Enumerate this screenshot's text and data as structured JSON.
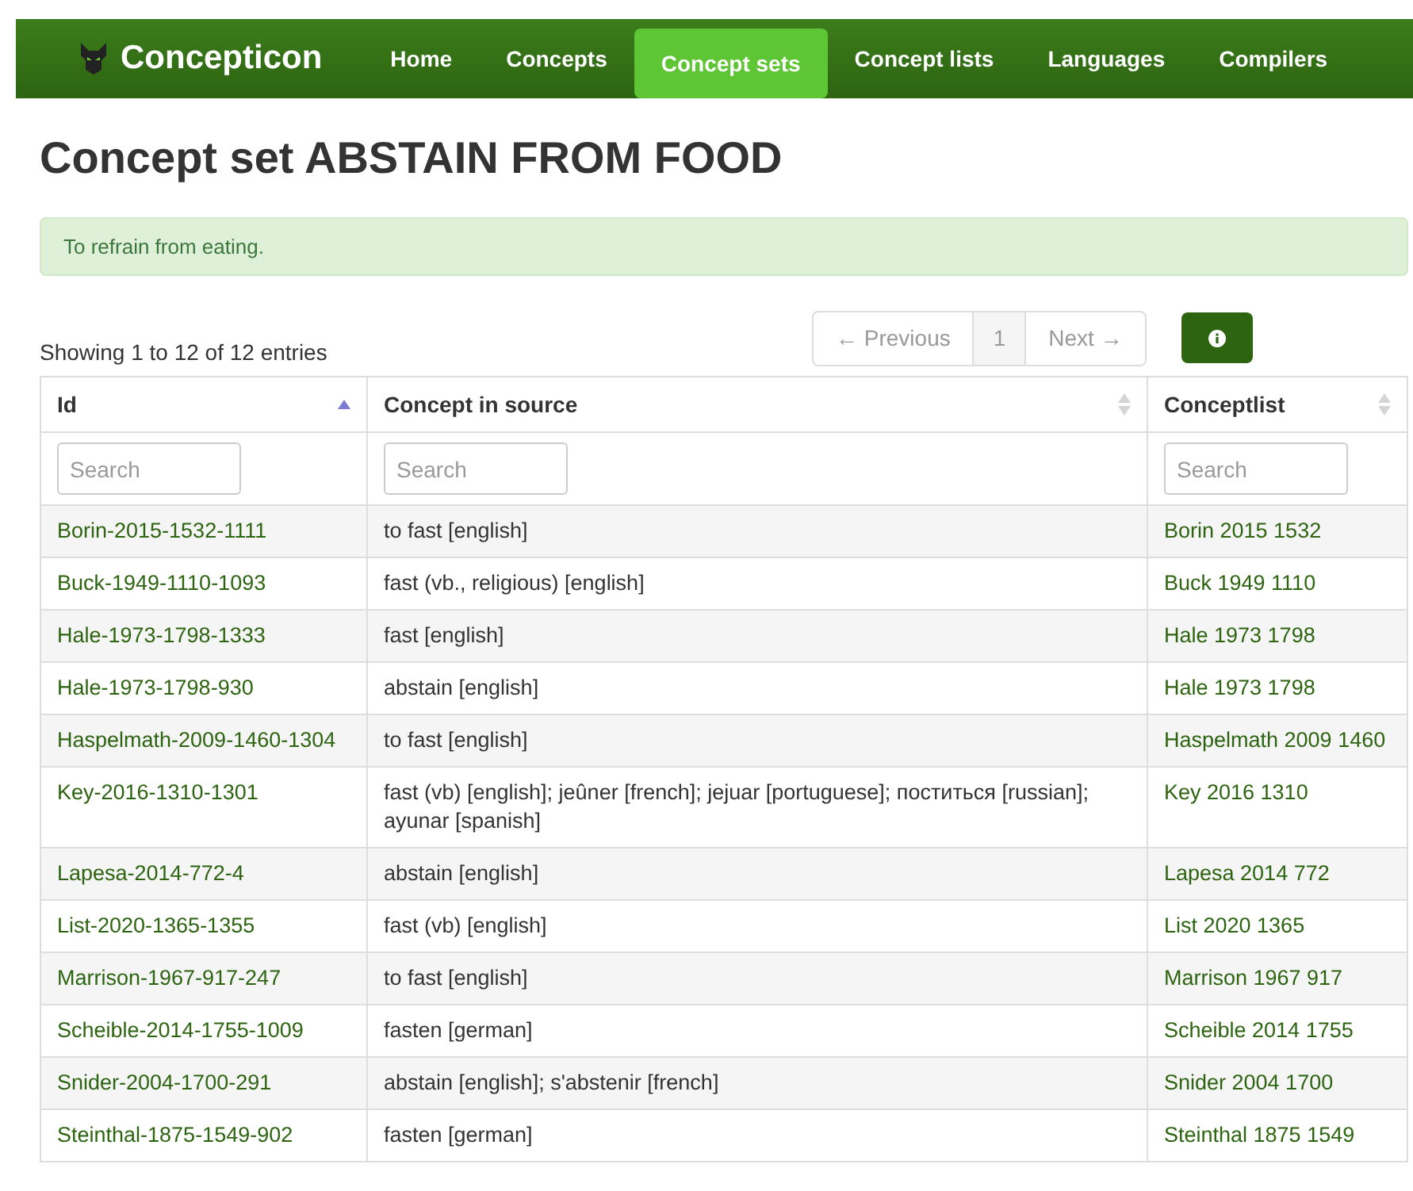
{
  "navbar": {
    "brand": "Concepticon",
    "items": [
      {
        "label": "Home",
        "selected": false
      },
      {
        "label": "Concepts",
        "selected": false
      },
      {
        "label": "Concept sets",
        "selected": true
      },
      {
        "label": "Concept lists",
        "selected": false
      },
      {
        "label": "Languages",
        "selected": false
      },
      {
        "label": "Compilers",
        "selected": false
      }
    ]
  },
  "title": "Concept set ABSTAIN FROM FOOD",
  "alert": "To refrain from eating.",
  "table_info": "Showing 1 to 12 of 12 entries",
  "pagination": [
    {
      "label": "← Previous",
      "selected": false
    },
    {
      "label": "1",
      "selected": true
    },
    {
      "label": "Next →",
      "selected": false
    }
  ],
  "table": {
    "columns": [
      {
        "label": "Id",
        "sorted": true,
        "placeholder": "Search"
      },
      {
        "label": "Concept in source",
        "sorted": false,
        "placeholder": "Search"
      },
      {
        "label": "Conceptlist",
        "sorted": false,
        "placeholder": "Search"
      }
    ],
    "rows": [
      [
        "Borin-2015-1532-1111",
        "to fast [english]",
        "Borin 2015 1532"
      ],
      [
        "Buck-1949-1110-1093",
        "fast (vb., religious) [english]",
        "Buck 1949 1110"
      ],
      [
        "Hale-1973-1798-1333",
        "fast [english]",
        "Hale 1973 1798"
      ],
      [
        "Hale-1973-1798-930",
        "abstain [english]",
        "Hale 1973 1798"
      ],
      [
        "Haspelmath-2009-1460-1304",
        "to fast [english]",
        "Haspelmath 2009 1460"
      ],
      [
        "Key-2016-1310-1301",
        "fast (vb) [english]; jeûner [french]; jejuar [portuguese]; поститься [russian]; ayunar [spanish]",
        "Key 2016 1310"
      ],
      [
        "Lapesa-2014-772-4",
        "abstain [english]",
        "Lapesa 2014 772"
      ],
      [
        "List-2020-1365-1355",
        "fast (vb) [english]",
        "List 2020 1365"
      ],
      [
        "Marrison-1967-917-247",
        "to fast [english]",
        "Marrison 1967 917"
      ],
      [
        "Scheible-2014-1755-1009",
        "fasten [german]",
        "Scheible 2014 1755"
      ],
      [
        "Snider-2004-1700-291",
        "abstain [english]; s'abstenir [french]",
        "Snider 2004 1700"
      ],
      [
        "Steinthal-1875-1549-902",
        "fasten [german]",
        "Steinthal 1875 1549"
      ]
    ]
  }
}
